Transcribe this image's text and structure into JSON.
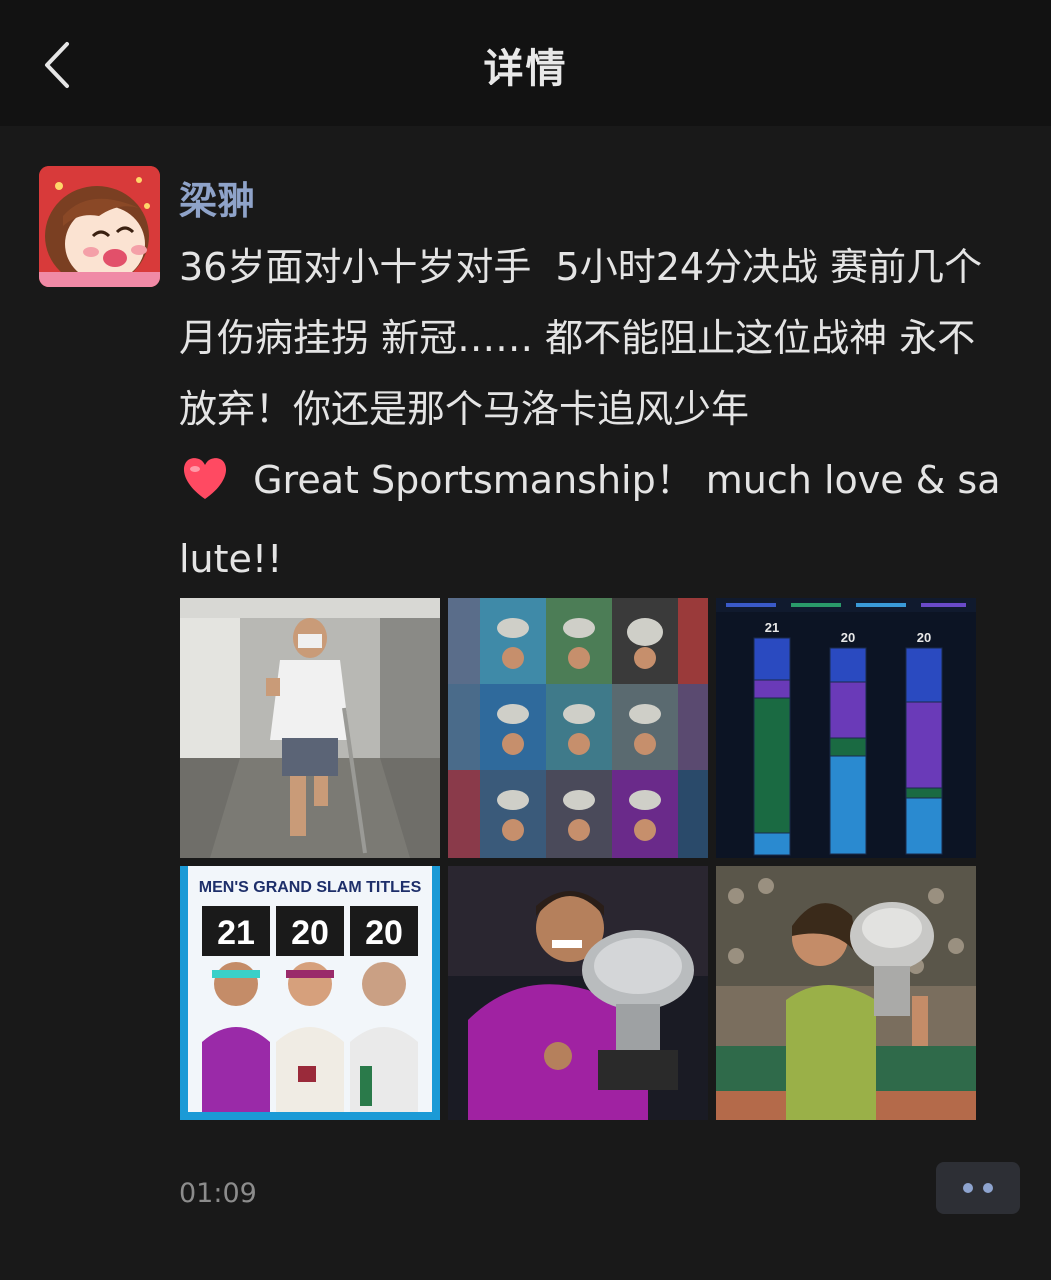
{
  "header": {
    "title": "详情",
    "back_icon": "chevron-left-icon"
  },
  "post": {
    "author": "梁翀",
    "text": "36岁面对小十岁对手  5小时24分决战 赛前几个月伤病挂拐 新冠…… 都不能阻止这位战神 永不放弃！你还是那个马洛卡追风少年",
    "text2": " Great Sportsmanship！ much love & salute!!",
    "heart_icon": "red-heart-emoji",
    "time": "01:09"
  },
  "images": [
    {
      "name": "photo-crutches",
      "desc_color": "#9a9a9a"
    },
    {
      "name": "photo-trophy-collage",
      "desc_color": "#3a6aa0"
    },
    {
      "name": "photo-title-bars",
      "desc_color": "#1b2c4a"
    },
    {
      "name": "photo-grand-slam-titles",
      "heading": "MEN'S GRAND SLAM TITLES",
      "counts": [
        "21",
        "20",
        "20"
      ]
    },
    {
      "name": "photo-ao-trophy",
      "desc_color": "#a0249b"
    },
    {
      "name": "photo-rg-trophy",
      "desc_color": "#8aa04a"
    }
  ],
  "chart_bars": {
    "values": [
      "21",
      "20",
      "20"
    ]
  },
  "colors": {
    "accent_name": "#8fa3c9",
    "bg": "#191919",
    "header_bg": "#121212"
  }
}
